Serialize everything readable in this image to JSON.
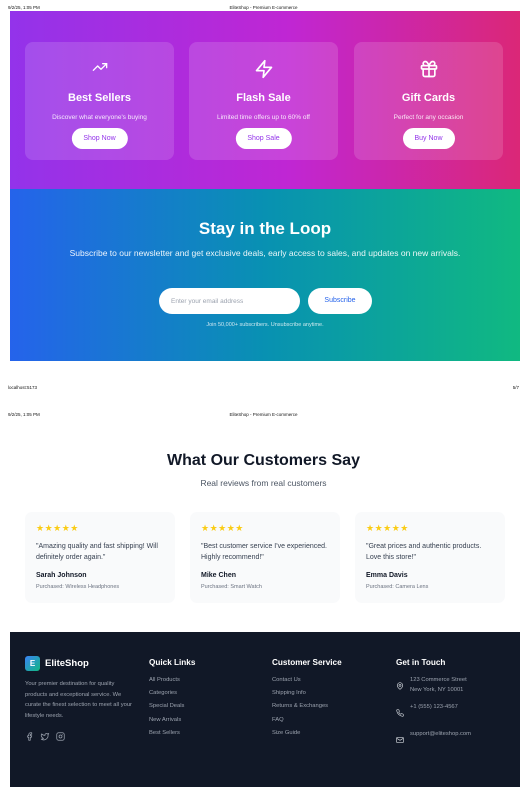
{
  "print": {
    "datetime": "9/2/25, 1:05 PM",
    "doc_title": "EliteShop - Premium E-commerce",
    "url": "localhost:5173",
    "page_number": "5/7"
  },
  "promos": [
    {
      "icon": "trending-up-icon",
      "title": "Best Sellers",
      "desc": "Discover what everyone's buying",
      "button": "Shop Now"
    },
    {
      "icon": "zap-icon",
      "title": "Flash Sale",
      "desc": "Limited time offers up to 60% off",
      "button": "Shop Sale"
    },
    {
      "icon": "gift-icon",
      "title": "Gift Cards",
      "desc": "Perfect for any occasion",
      "button": "Buy Now"
    }
  ],
  "newsletter": {
    "title": "Stay in the Loop",
    "subtitle": "Subscribe to our newsletter and get exclusive deals, early access to sales, and updates on new arrivals.",
    "placeholder": "Enter your email address",
    "button": "Subscribe",
    "note": "Join 50,000+ subscribers. Unsubscribe anytime."
  },
  "testimonials": {
    "title": "What Our Customers Say",
    "subtitle": "Real reviews from real customers",
    "stars": "★★★★★",
    "items": [
      {
        "rating": 5,
        "quote": "\"Amazing quality and fast shipping! Will definitely order again.\"",
        "name": "Sarah Johnson",
        "product": "Purchased: Wireless Headphones"
      },
      {
        "rating": 5,
        "quote": "\"Best customer service I've experienced. Highly recommend!\"",
        "name": "Mike Chen",
        "product": "Purchased: Smart Watch"
      },
      {
        "rating": 5,
        "quote": "\"Great prices and authentic products. Love this store!\"",
        "name": "Emma Davis",
        "product": "Purchased: Camera Lens"
      }
    ]
  },
  "footer": {
    "logo_letter": "E",
    "brand": "EliteShop",
    "description": "Your premier destination for quality products and exceptional service. We curate the finest selection to meet all your lifestyle needs.",
    "quick_links": {
      "title": "Quick Links",
      "items": [
        "All Products",
        "Categories",
        "Special Deals",
        "New Arrivals",
        "Best Sellers"
      ]
    },
    "customer_service": {
      "title": "Customer Service",
      "items": [
        "Contact Us",
        "Shipping Info",
        "Returns & Exchanges",
        "FAQ",
        "Size Guide"
      ]
    },
    "contact": {
      "title": "Get in Touch",
      "address": "123 Commerce Street\nNew York, NY 10001",
      "phone": "+1 (555) 123-4567",
      "email": "support@eliteshop.com"
    }
  },
  "colors": {
    "promo_gradient": [
      "#9333ea",
      "#db2777"
    ],
    "newsletter_gradient": [
      "#2563eb",
      "#10b981"
    ],
    "star": "#facc15",
    "footer_bg": "#111827"
  }
}
